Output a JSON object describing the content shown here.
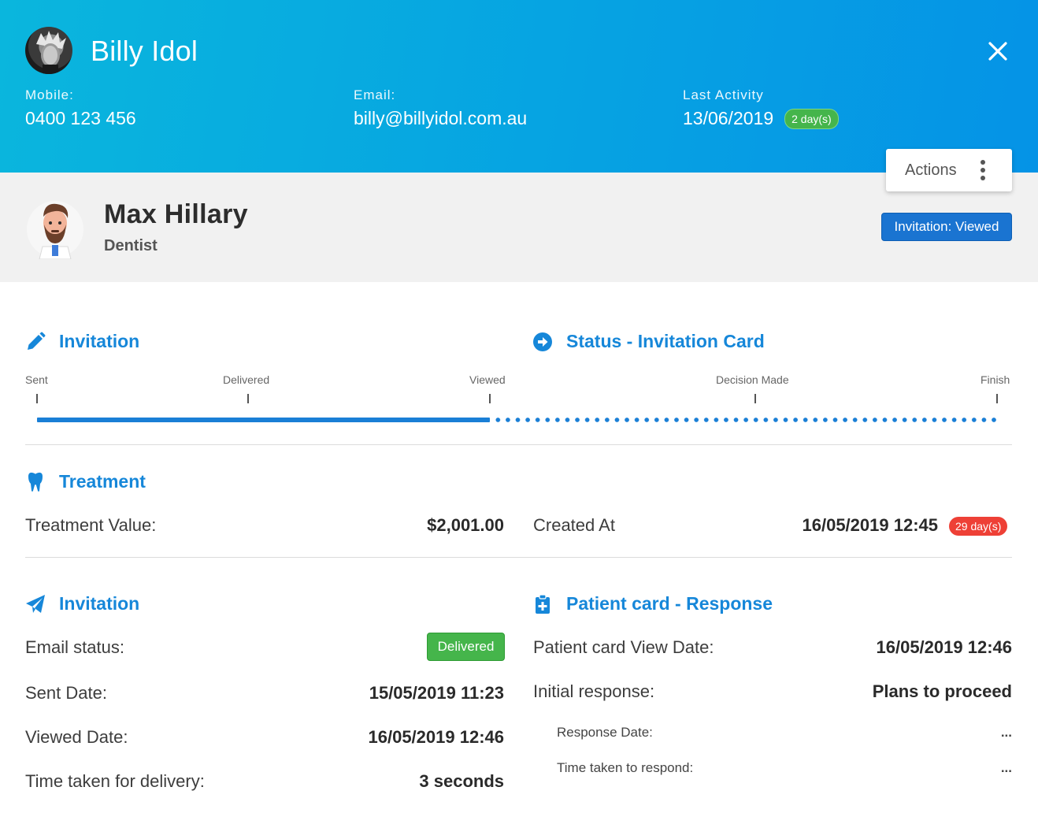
{
  "header": {
    "patient_name": "Billy Idol",
    "mobile": {
      "label": "Mobile:",
      "value": "0400 123 456"
    },
    "email": {
      "label": "Email:",
      "value": "billy@billyidol.com.au"
    },
    "last_activity": {
      "label": "Last Activity",
      "value": "13/06/2019",
      "badge": "2 day(s)"
    },
    "close_icon": "close-icon"
  },
  "provider": {
    "name": "Max Hillary",
    "role": "Dentist",
    "actions_label": "Actions",
    "status_badge": "Invitation: Viewed"
  },
  "timeline": {
    "left_title": "Invitation",
    "right_title": "Status - Invitation Card",
    "steps": [
      "Sent",
      "Delivered",
      "Viewed",
      "Decision Made",
      "Finish"
    ],
    "current_step": "Viewed",
    "progress_fraction": 0.5
  },
  "treatment": {
    "title": "Treatment",
    "value_label": "Treatment Value:",
    "value": "$2,001.00",
    "created_label": "Created At",
    "created_value": "16/05/2019 12:45",
    "created_badge": "29 day(s)"
  },
  "invitation": {
    "title": "Invitation",
    "email_status_label": "Email status:",
    "email_status": "Delivered",
    "sent_label": "Sent Date:",
    "sent_value": "15/05/2019 11:23",
    "viewed_label": "Viewed Date:",
    "viewed_value": "16/05/2019 12:46",
    "delivery_label": "Time taken for delivery:",
    "delivery_value": "3 seconds"
  },
  "patient_card": {
    "title": "Patient card - Response",
    "view_date_label": "Patient card View Date:",
    "view_date_value": "16/05/2019 12:46",
    "initial_response_label": "Initial response:",
    "initial_response_value": "Plans to proceed",
    "response_date_label": "Response Date:",
    "response_date_value": "...",
    "time_to_respond_label": "Time taken to respond:",
    "time_to_respond_value": "..."
  },
  "colors": {
    "header_gradient_start": "#0ab6dd",
    "header_gradient_end": "#0593e6",
    "accent_blue": "#1687d9",
    "status_blue": "#1a74d1",
    "success_green": "#45b54b",
    "danger_red": "#ee4036",
    "provider_band": "#f1f1f1"
  }
}
